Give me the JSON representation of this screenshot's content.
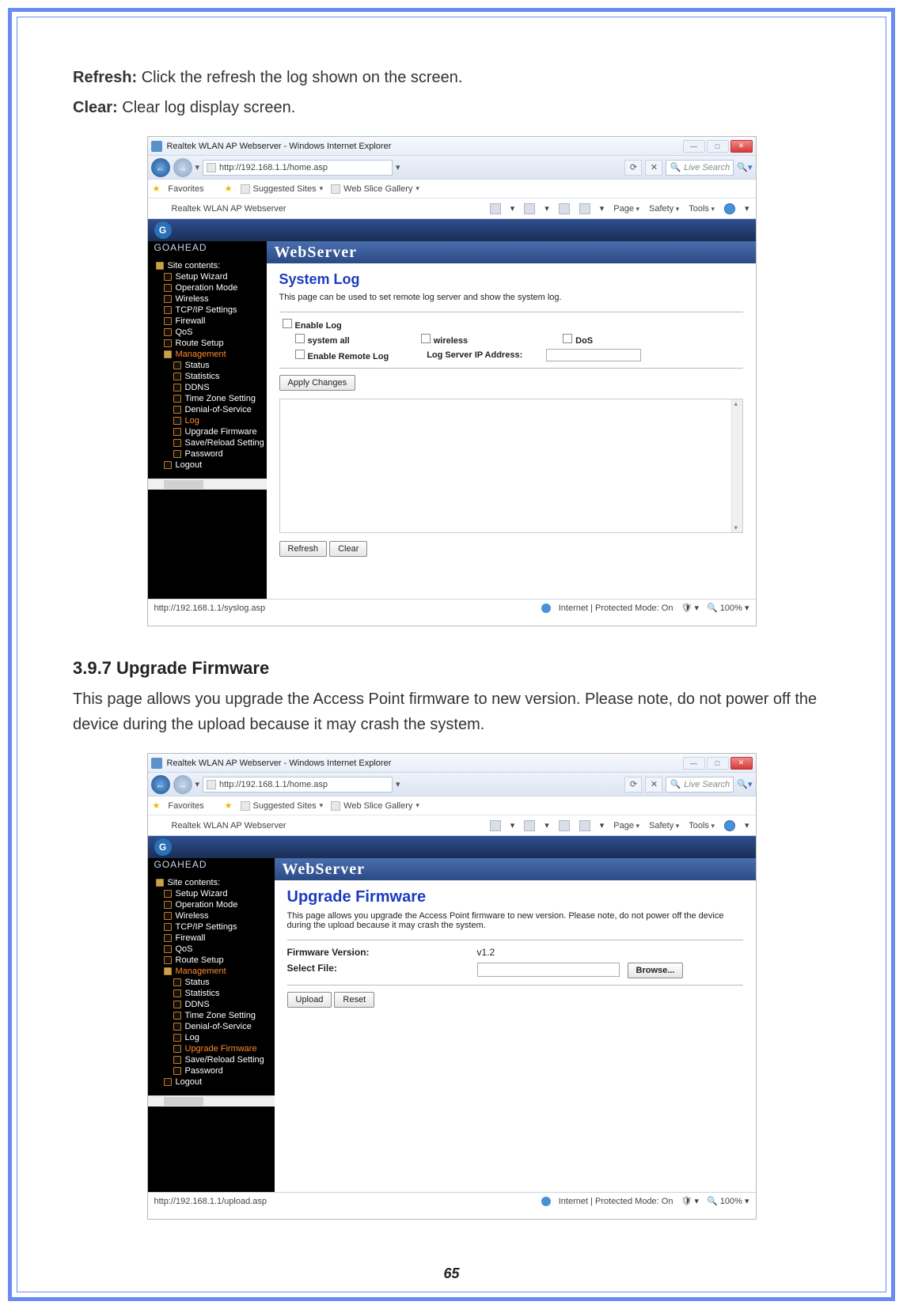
{
  "doc": {
    "refresh_label": "Refresh:",
    "refresh_text": " Click the refresh the log shown on the screen.",
    "clear_label": "Clear:",
    "clear_text": " Clear log display screen.",
    "section_heading": "3.9.7 Upgrade Firmware",
    "section_text": "This page allows you upgrade the Access Point firmware to new version. Please note, do not power off the device during the upload because it may crash the system.",
    "page_number": "65"
  },
  "common": {
    "window_title": "Realtek WLAN AP Webserver - Windows Internet Explorer",
    "tab_title": "Realtek WLAN AP Webserver",
    "url": "http://192.168.1.1/home.asp",
    "search_placeholder": "Live Search",
    "fav_label": "Favorites",
    "suggested": "Suggested Sites",
    "webslice": "Web Slice Gallery",
    "menu_page": "Page",
    "menu_safety": "Safety",
    "menu_tools": "Tools",
    "internet_mode": "Internet | Protected Mode: On",
    "zoom": "100%",
    "goahead": "GOAHEAD",
    "webserver": "WebServer",
    "site_contents": "Site contents:",
    "logout": "Logout"
  },
  "sidebar_items_1": [
    "Setup Wizard",
    "Operation Mode",
    "Wireless",
    "TCP/IP Settings",
    "Firewall",
    "QoS",
    "Route Setup"
  ],
  "sidebar_mgmt": "Management",
  "sidebar_sub_1": [
    "Status",
    "Statistics",
    "DDNS",
    "Time Zone Setting",
    "Denial-of-Service"
  ],
  "sidebar_log": "Log",
  "sidebar_after_log": [
    "Upgrade Firmware",
    "Save/Reload Setting",
    "Password"
  ],
  "syslog": {
    "title": "System Log",
    "desc": "This page can be used to set remote log server and show the system log.",
    "enable_log": "Enable Log",
    "system_all": "system all",
    "wireless": "wireless",
    "dos": "DoS",
    "enable_remote": "Enable Remote Log",
    "log_server": "Log Server IP Address:",
    "apply": "Apply Changes",
    "refresh": "Refresh",
    "clear": "Clear",
    "status_url": "http://192.168.1.1/syslog.asp"
  },
  "upgrade": {
    "title": "Upgrade Firmware",
    "desc": "This page allows you upgrade the Access Point firmware to new version. Please note, do not power off the device during the upload because it may crash the system.",
    "fw_label": "Firmware Version:",
    "fw_value": "v1.2",
    "select_file": "Select File:",
    "browse": "Browse...",
    "upload": "Upload",
    "reset": "Reset",
    "status_url": "http://192.168.1.1/upload.asp",
    "sel_item": "Upgrade Firmware"
  }
}
